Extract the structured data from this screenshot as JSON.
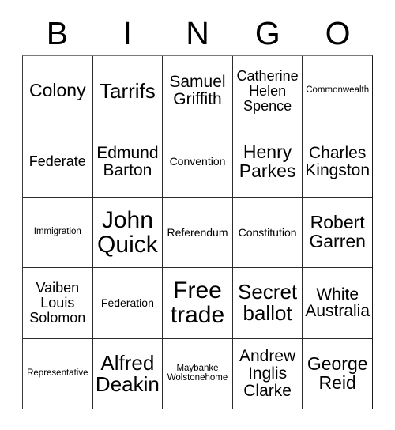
{
  "card": {
    "header_letters": [
      "B",
      "I",
      "N",
      "G",
      "O"
    ],
    "rows": [
      {
        "cells": [
          {
            "text": "Colony",
            "size": "lg"
          },
          {
            "text": "Tarrifs",
            "size": "xl"
          },
          {
            "text": "Samuel Griffith",
            "size": "md"
          },
          {
            "text": "Catherine Helen Spence",
            "size": "sm"
          },
          {
            "text": "Commonwealth",
            "size": "xxs"
          }
        ]
      },
      {
        "cells": [
          {
            "text": "Federate",
            "size": "sm"
          },
          {
            "text": "Edmund Barton",
            "size": "md"
          },
          {
            "text": "Convention",
            "size": "xs"
          },
          {
            "text": "Henry Parkes",
            "size": "lg"
          },
          {
            "text": "Charles Kingston",
            "size": "md"
          }
        ]
      },
      {
        "cells": [
          {
            "text": "Immigration",
            "size": "xxs"
          },
          {
            "text": "John Quick",
            "size": "xxl"
          },
          {
            "text": "Referendum",
            "size": "xs"
          },
          {
            "text": "Constitution",
            "size": "xs"
          },
          {
            "text": "Robert Garren",
            "size": "lg"
          }
        ]
      },
      {
        "cells": [
          {
            "text": "Vaiben Louis Solomon",
            "size": "sm"
          },
          {
            "text": "Federation",
            "size": "xs"
          },
          {
            "text": "Free trade",
            "size": "xxl"
          },
          {
            "text": "Secret ballot",
            "size": "xl"
          },
          {
            "text": "White Australia",
            "size": "md"
          }
        ]
      },
      {
        "cells": [
          {
            "text": "Representative",
            "size": "xxs"
          },
          {
            "text": "Alfred Deakin",
            "size": "xl"
          },
          {
            "text": "Maybanke Wolstonehome",
            "size": "xxs"
          },
          {
            "text": "Andrew Inglis Clarke",
            "size": "md"
          },
          {
            "text": "George Reid",
            "size": "lg"
          }
        ]
      }
    ]
  },
  "colors": {
    "background": "#ffffff",
    "text": "#000000",
    "grid_line": "#2b2b2b"
  }
}
